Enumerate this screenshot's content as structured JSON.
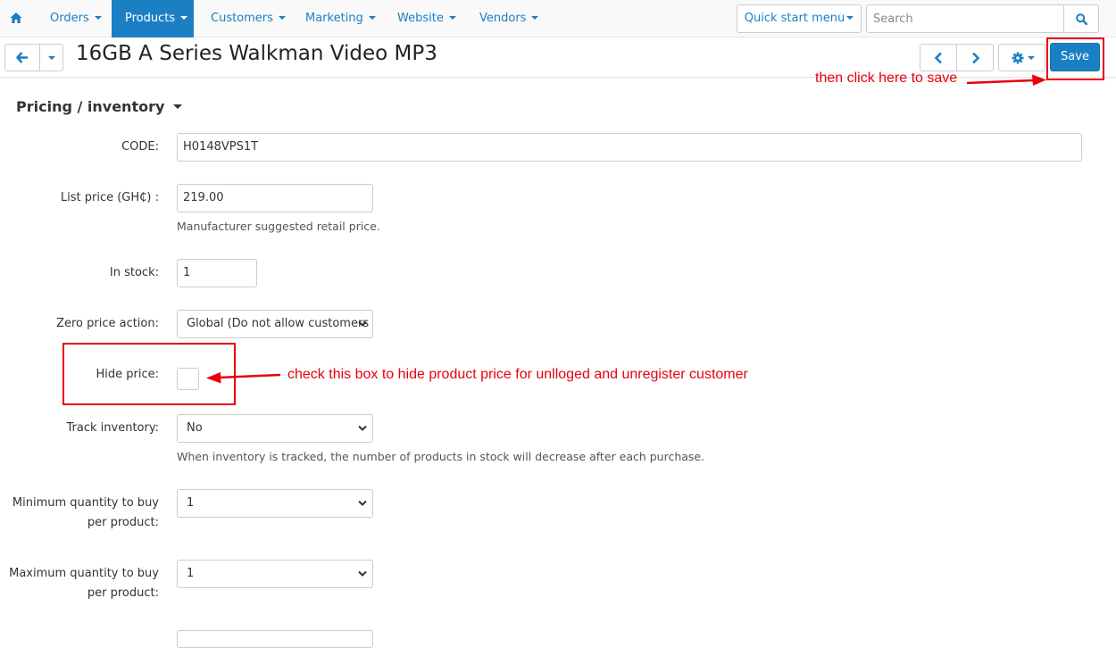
{
  "nav": {
    "items": [
      {
        "label": "Orders"
      },
      {
        "label": "Products"
      },
      {
        "label": "Customers"
      },
      {
        "label": "Marketing"
      },
      {
        "label": "Website"
      },
      {
        "label": "Vendors"
      }
    ],
    "active": "Products",
    "quick_start": "Quick start menu",
    "search_placeholder": "Search"
  },
  "titlebar": {
    "title": "16GB A Series Walkman Video MP3",
    "save_label": "Save"
  },
  "section": {
    "title": "Pricing / inventory"
  },
  "form": {
    "code_label": "CODE:",
    "code_value": "H0148VPS1T",
    "list_price_label": "List price (GH₵) :",
    "list_price_value": "219.00",
    "list_price_hint": "Manufacturer suggested retail price.",
    "in_stock_label": "In stock:",
    "in_stock_value": "1",
    "zero_price_label": "Zero price action:",
    "zero_price_value": "Global (Do not allow customers",
    "hide_price_label": "Hide price:",
    "track_inventory_label": "Track inventory:",
    "track_inventory_value": "No",
    "track_inventory_hint": "When inventory is tracked, the number of products in stock will decrease after each purchase.",
    "min_qty_label": "Minimum quantity to buy per product:",
    "min_qty_value": "1",
    "max_qty_label": "Maximum quantity to buy per product:",
    "max_qty_value": "1"
  },
  "annotations": {
    "save_note": "then click here to save",
    "checkbox_note": "check this box to hide product price for unlloged and unregister customer",
    "color": "#e8000b"
  },
  "colors": {
    "accent": "#1b7fc4"
  }
}
